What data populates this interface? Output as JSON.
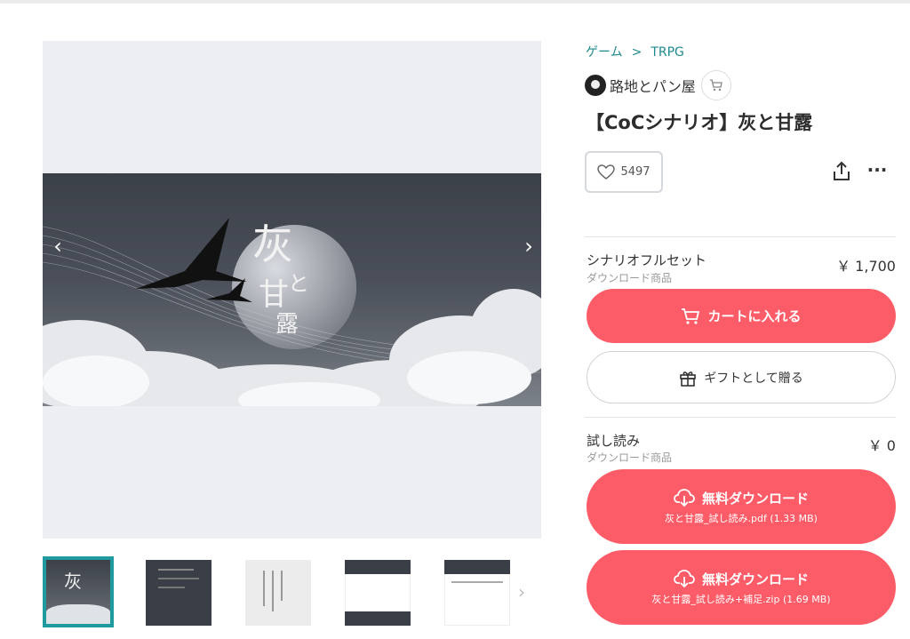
{
  "breadcrumb": {
    "items": [
      "ゲーム",
      "TRPG"
    ],
    "separator": ">"
  },
  "shop": {
    "name": "路地とパン屋"
  },
  "product": {
    "title": "【CoCシナリオ】灰と甘露",
    "likes": "5497"
  },
  "hero": {
    "title_char1": "灰",
    "title_char2": "と",
    "title_char3": "甘",
    "title_char4": "露"
  },
  "items": [
    {
      "name": "シナリオフルセット",
      "type": "ダウンロード商品",
      "price": "￥ 1,700"
    },
    {
      "name": "試し読み",
      "type": "ダウンロード商品",
      "price": "￥ 0"
    }
  ],
  "buttons": {
    "add_to_cart": "カートに入れる",
    "gift": "ギフトとして贈る",
    "download_label": "無料ダウンロード",
    "download1_file": "灰と甘露_試し読み.pdf (1.33 MB)",
    "download2_file": "灰と甘露_試し読み+補足.zip (1.69 MB)"
  },
  "colors": {
    "accent": "#fc5c68",
    "link": "#1f8a8f",
    "active_thumb_border": "#1f9ba0"
  },
  "icons": [
    "chevron-left-icon",
    "chevron-right-icon",
    "heart-icon",
    "share-icon",
    "more-icon",
    "cart-icon",
    "gift-icon",
    "download-cloud-icon"
  ]
}
